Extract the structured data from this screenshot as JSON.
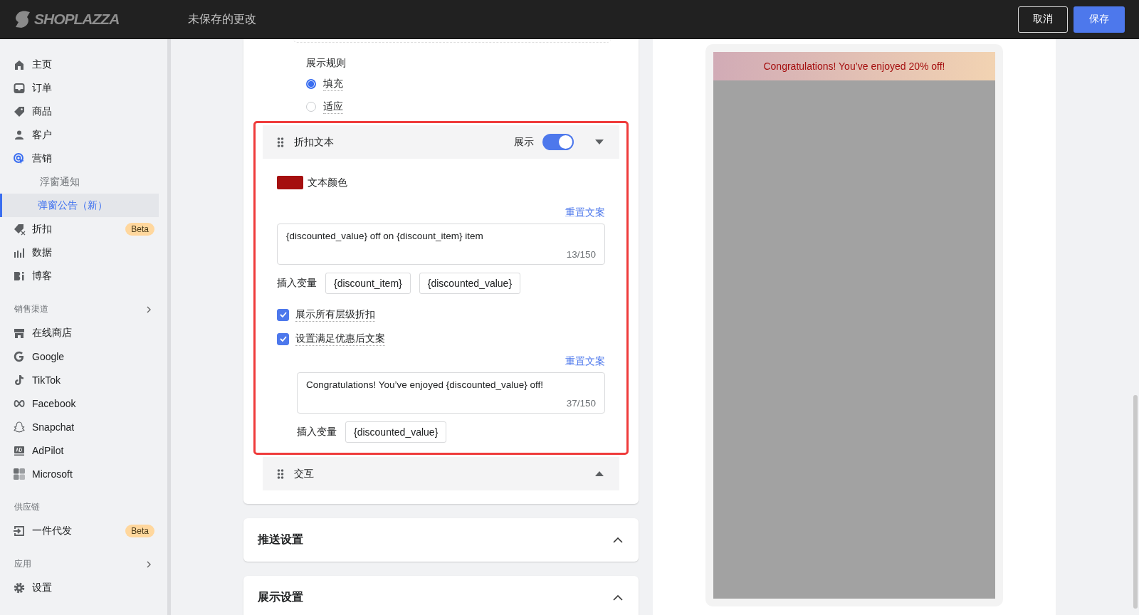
{
  "topbar": {
    "logo": "SHOPLAZZA",
    "title": "未保存的更改",
    "buttons": [
      {
        "label": "取消",
        "kind": "secondary"
      },
      {
        "label": "保存",
        "kind": "primary"
      }
    ]
  },
  "sidebar": {
    "groups": [
      {
        "items": [
          {
            "label": "主页",
            "selected": false
          },
          {
            "label": "订单",
            "selected": false
          },
          {
            "label": "商品",
            "selected": false
          },
          {
            "label": "客户",
            "selected": false
          },
          {
            "label": "营销",
            "selected": false,
            "children": [
              {
                "label": "浮窗通知",
                "selected": false
              },
              {
                "label": "弹窗公告（新）",
                "selected": true
              }
            ]
          },
          {
            "label": "折扣",
            "selected": false,
            "badge": "Beta"
          },
          {
            "label": "数据",
            "selected": false
          },
          {
            "label": "博客",
            "selected": false
          }
        ]
      },
      {
        "title": "销售渠道",
        "arrow": true,
        "items": [
          {
            "label": "在线商店",
            "selected": false
          },
          {
            "label": "Google",
            "selected": false
          },
          {
            "label": "TikTok",
            "selected": false
          },
          {
            "label": "Facebook",
            "selected": false
          },
          {
            "label": "Snapchat",
            "selected": false
          },
          {
            "label": "AdPilot",
            "selected": false
          },
          {
            "label": "Microsoft",
            "selected": false
          }
        ]
      },
      {
        "title": "供应链",
        "arrow": false,
        "items": [
          {
            "label": "一件代发",
            "selected": false,
            "badge": "Beta"
          }
        ]
      },
      {
        "title": "应用",
        "arrow": true
      },
      {
        "items": [
          {
            "label": "设置",
            "selected": false
          }
        ]
      }
    ]
  },
  "settings": {
    "display_rule": {
      "label": "展示规则",
      "options": [
        {
          "label": "填充",
          "selected": true
        },
        {
          "label": "适应",
          "selected": false
        }
      ]
    },
    "sections": [
      {
        "title": "折扣文本",
        "highlighted": true,
        "expanded": true,
        "show_label": "展示",
        "show_on": true,
        "color_label": "文本颜色",
        "color": "#a50f0f",
        "reset_label": "重置文案",
        "text": "{discounted_value} off on {discount_item} item",
        "count": "13/150",
        "insert_label": "插入变量",
        "variables": [
          "{discount_item}",
          "{discounted_value}"
        ],
        "checkboxes": [
          {
            "label": "展示所有层级折扣",
            "checked": true
          },
          {
            "label": "设置满足优惠后文案",
            "checked": true
          }
        ],
        "reset_label_2": "重置文案",
        "text_2": "Congratulations! You’ve enjoyed {discounted_value} off!",
        "count_2": "37/150",
        "insert_label_2": "插入变量",
        "variables_2": [
          "{discounted_value}"
        ]
      },
      {
        "title": "交互",
        "highlighted": false,
        "expanded": false
      }
    ],
    "cards": [
      {
        "title": "推送设置"
      },
      {
        "title": "展示设置"
      }
    ]
  },
  "preview": {
    "banner": "Congratulations! You’ve enjoyed 20% off!"
  }
}
